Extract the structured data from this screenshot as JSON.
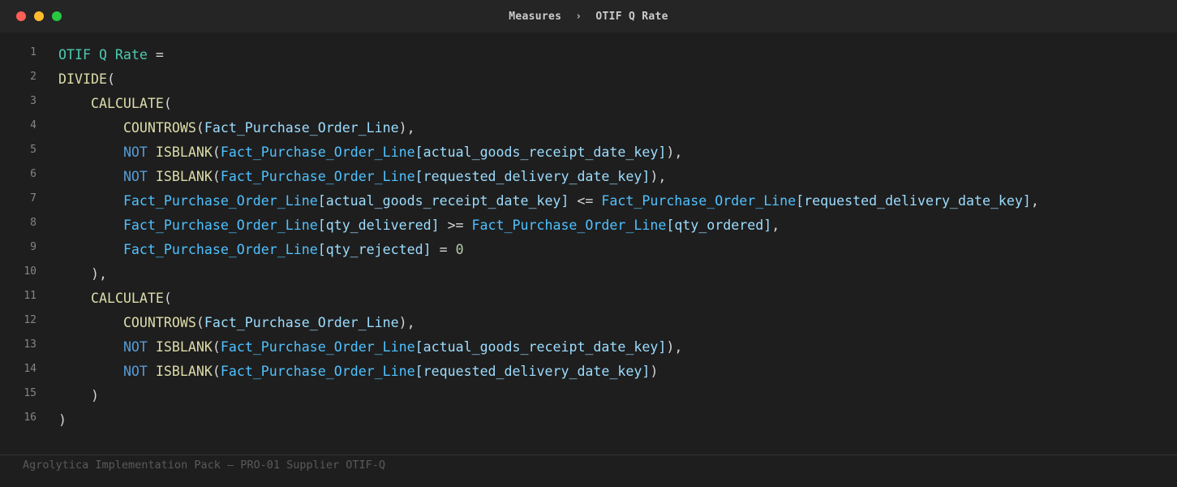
{
  "window": {
    "breadcrumb": [
      "Measures",
      "OTIF Q Rate"
    ],
    "separator": "›"
  },
  "code": {
    "language": "DAX",
    "lines": [
      {
        "n": "1",
        "tokens": [
          {
            "t": "OTIF Q Rate",
            "c": "name"
          },
          {
            "t": " =",
            "c": "op"
          }
        ]
      },
      {
        "n": "2",
        "tokens": [
          {
            "t": "DIVIDE",
            "c": "fn"
          },
          {
            "t": "(",
            "c": "op"
          }
        ]
      },
      {
        "n": "3",
        "tokens": [
          {
            "t": "    ",
            "c": "op"
          },
          {
            "t": "CALCULATE",
            "c": "fn"
          },
          {
            "t": "(",
            "c": "op"
          }
        ]
      },
      {
        "n": "4",
        "tokens": [
          {
            "t": "        ",
            "c": "op"
          },
          {
            "t": "COUNTROWS",
            "c": "fn"
          },
          {
            "t": "(",
            "c": "op"
          },
          {
            "t": "Fact_Purchase_Order_Line",
            "c": "col"
          },
          {
            "t": "),",
            "c": "op"
          }
        ]
      },
      {
        "n": "5",
        "tokens": [
          {
            "t": "        ",
            "c": "op"
          },
          {
            "t": "NOT",
            "c": "kw"
          },
          {
            "t": " ",
            "c": "op"
          },
          {
            "t": "ISBLANK",
            "c": "fn"
          },
          {
            "t": "(",
            "c": "op"
          },
          {
            "t": "Fact_Purchase_Order_Line",
            "c": "tbl"
          },
          {
            "t": "[actual_goods_receipt_date_key]",
            "c": "col"
          },
          {
            "t": "),",
            "c": "op"
          }
        ]
      },
      {
        "n": "6",
        "tokens": [
          {
            "t": "        ",
            "c": "op"
          },
          {
            "t": "NOT",
            "c": "kw"
          },
          {
            "t": " ",
            "c": "op"
          },
          {
            "t": "ISBLANK",
            "c": "fn"
          },
          {
            "t": "(",
            "c": "op"
          },
          {
            "t": "Fact_Purchase_Order_Line",
            "c": "tbl"
          },
          {
            "t": "[requested_delivery_date_key]",
            "c": "col"
          },
          {
            "t": "),",
            "c": "op"
          }
        ]
      },
      {
        "n": "7",
        "tokens": [
          {
            "t": "        ",
            "c": "op"
          },
          {
            "t": "Fact_Purchase_Order_Line",
            "c": "tbl"
          },
          {
            "t": "[actual_goods_receipt_date_key]",
            "c": "col"
          },
          {
            "t": " <= ",
            "c": "op"
          },
          {
            "t": "Fact_Purchase_Order_Line",
            "c": "tbl"
          },
          {
            "t": "[requested_delivery_date_key]",
            "c": "col"
          },
          {
            "t": ",",
            "c": "op"
          }
        ]
      },
      {
        "n": "8",
        "tokens": [
          {
            "t": "        ",
            "c": "op"
          },
          {
            "t": "Fact_Purchase_Order_Line",
            "c": "tbl"
          },
          {
            "t": "[qty_delivered]",
            "c": "col"
          },
          {
            "t": " >= ",
            "c": "op"
          },
          {
            "t": "Fact_Purchase_Order_Line",
            "c": "tbl"
          },
          {
            "t": "[qty_ordered]",
            "c": "col"
          },
          {
            "t": ",",
            "c": "op"
          }
        ]
      },
      {
        "n": "9",
        "tokens": [
          {
            "t": "        ",
            "c": "op"
          },
          {
            "t": "Fact_Purchase_Order_Line",
            "c": "tbl"
          },
          {
            "t": "[qty_rejected]",
            "c": "col"
          },
          {
            "t": " = ",
            "c": "op"
          },
          {
            "t": "0",
            "c": "num"
          }
        ]
      },
      {
        "n": "10",
        "tokens": [
          {
            "t": "    ),",
            "c": "op"
          }
        ]
      },
      {
        "n": "11",
        "tokens": [
          {
            "t": "    ",
            "c": "op"
          },
          {
            "t": "CALCULATE",
            "c": "fn"
          },
          {
            "t": "(",
            "c": "op"
          }
        ]
      },
      {
        "n": "12",
        "tokens": [
          {
            "t": "        ",
            "c": "op"
          },
          {
            "t": "COUNTROWS",
            "c": "fn"
          },
          {
            "t": "(",
            "c": "op"
          },
          {
            "t": "Fact_Purchase_Order_Line",
            "c": "col"
          },
          {
            "t": "),",
            "c": "op"
          }
        ]
      },
      {
        "n": "13",
        "tokens": [
          {
            "t": "        ",
            "c": "op"
          },
          {
            "t": "NOT",
            "c": "kw"
          },
          {
            "t": " ",
            "c": "op"
          },
          {
            "t": "ISBLANK",
            "c": "fn"
          },
          {
            "t": "(",
            "c": "op"
          },
          {
            "t": "Fact_Purchase_Order_Line",
            "c": "tbl"
          },
          {
            "t": "[actual_goods_receipt_date_key]",
            "c": "col"
          },
          {
            "t": "),",
            "c": "op"
          }
        ]
      },
      {
        "n": "14",
        "tokens": [
          {
            "t": "        ",
            "c": "op"
          },
          {
            "t": "NOT",
            "c": "kw"
          },
          {
            "t": " ",
            "c": "op"
          },
          {
            "t": "ISBLANK",
            "c": "fn"
          },
          {
            "t": "(",
            "c": "op"
          },
          {
            "t": "Fact_Purchase_Order_Line",
            "c": "tbl"
          },
          {
            "t": "[requested_delivery_date_key]",
            "c": "col"
          },
          {
            "t": ")",
            "c": "op"
          }
        ]
      },
      {
        "n": "15",
        "tokens": [
          {
            "t": "    )",
            "c": "op"
          }
        ]
      },
      {
        "n": "16",
        "tokens": [
          {
            "t": ")",
            "c": "op"
          }
        ]
      }
    ]
  },
  "footer": {
    "text": "Agrolytica Implementation Pack — PRO-01 Supplier OTIF-Q"
  },
  "colors": {
    "background": "#1e1e1e",
    "titlebar": "#252526",
    "measure_name": "#4ec9b0",
    "function": "#dcdcaa",
    "keyword": "#569cd6",
    "table": "#4fc1ff",
    "column": "#9cdcfe",
    "number": "#b5cea8"
  },
  "icons": [
    "window-close-icon",
    "window-minimize-icon",
    "window-maximize-icon"
  ]
}
